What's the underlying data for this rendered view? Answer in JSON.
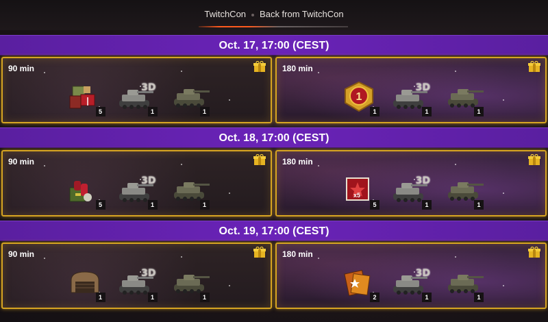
{
  "tabs": [
    {
      "label": "TwitchCon"
    },
    {
      "label": "Back from TwitchCon"
    }
  ],
  "days": [
    {
      "header": "Oct. 17, 17:00 (CEST)",
      "left": {
        "duration": "90 min",
        "items": [
          {
            "icon": "supply-crates-icon",
            "count": "5"
          },
          {
            "icon": "tank-3d-style-icon",
            "tag": "3D",
            "count": "1"
          },
          {
            "icon": "tank-icon",
            "count": "1"
          }
        ]
      },
      "right": {
        "duration": "180 min",
        "items": [
          {
            "icon": "rank-1-badge-icon",
            "count": "1"
          },
          {
            "icon": "tank-3d-style-icon",
            "tag": "3D",
            "count": "1"
          },
          {
            "icon": "tank-icon",
            "count": "1"
          }
        ]
      }
    },
    {
      "header": "Oct. 18, 17:00 (CEST)",
      "left": {
        "duration": "90 min",
        "items": [
          {
            "icon": "consumables-kit-icon",
            "count": "5"
          },
          {
            "icon": "tank-3d-style-icon",
            "tag": "3D",
            "count": "1"
          },
          {
            "icon": "tank-icon",
            "count": "1"
          }
        ]
      },
      "right": {
        "duration": "180 min",
        "items": [
          {
            "icon": "x5-booster-icon",
            "badge": "x5",
            "count": "5"
          },
          {
            "icon": "tank-3d-style-icon",
            "tag": "3D",
            "count": "1"
          },
          {
            "icon": "tank-icon",
            "count": "1"
          }
        ]
      }
    },
    {
      "header": "Oct. 19, 17:00 (CEST)",
      "left": {
        "duration": "90 min",
        "items": [
          {
            "icon": "hangar-slot-icon",
            "count": "1"
          },
          {
            "icon": "tank-3d-style-icon",
            "tag": "3D",
            "count": "1"
          },
          {
            "icon": "tank-icon",
            "count": "1"
          }
        ]
      },
      "right": {
        "duration": "180 min",
        "items": [
          {
            "icon": "crew-book-icon",
            "count": "2"
          },
          {
            "icon": "tank-3d-style-icon",
            "tag": "3D",
            "count": "1"
          },
          {
            "icon": "tank-icon",
            "count": "1"
          }
        ]
      }
    }
  ],
  "colors": {
    "header_purple": "#6a23b8",
    "card_border_gold": "#d6a422",
    "tab_accent_orange": "#ff5a1e"
  }
}
